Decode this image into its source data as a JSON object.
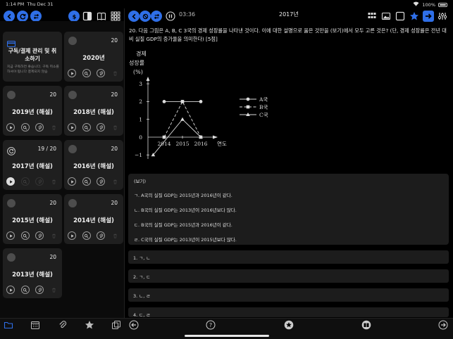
{
  "status": {
    "time": "1:14 PM",
    "date": "Thu Dec 31",
    "battery": "100%"
  },
  "left_panel": {
    "cards": [
      {
        "title": "구독/결제 관리 및 취소하기",
        "subtitle": "지금 구독하면 좋습니다. 구독 취소를 하셔야 됩니다 결제되지 않습",
        "count": ""
      },
      {
        "title": "2020년",
        "count": "20"
      },
      {
        "title": "2019년 (해설)",
        "count": "20"
      },
      {
        "title": "2018년 (해설)",
        "count": "20"
      },
      {
        "title": "2017년 (해설)",
        "count": "19 / 20"
      },
      {
        "title": "2016년 (해설)",
        "count": "20"
      },
      {
        "title": "2015년 (해설)",
        "count": "20"
      },
      {
        "title": "2014년 (해설)",
        "count": "20"
      },
      {
        "title": "2013년 (해설)",
        "count": "20"
      }
    ]
  },
  "header": {
    "title": "2017년",
    "timer": "03:36"
  },
  "question": {
    "text": "20. 다음 그림은 A, B, C 3국의 경제 성장률을 나타낸 것이다. 이에 대한 설명으로 옳은 것만을 (보기)에서 모두 고른 것은? (단, 경제 성장률은 전년 대비 실질 GDP의 증가율을 의미한다) [5점]"
  },
  "chart_data": {
    "type": "line",
    "ylabel_line1": "경제",
    "ylabel_line2": "성장률",
    "ylabel_unit": "(%)",
    "xlabel": "연도",
    "categories": [
      "2014",
      "2015",
      "2016"
    ],
    "y_ticks": [
      "3",
      "2",
      "1",
      "0",
      "−1"
    ],
    "x_origin_label": "0",
    "ylim": [
      -1,
      3
    ],
    "series": [
      {
        "name": "A국",
        "marker": "circle",
        "style": "solid",
        "x": [
          2014,
          2015,
          2016
        ],
        "values": [
          2,
          2,
          2
        ]
      },
      {
        "name": "B국",
        "marker": "square",
        "style": "dashed",
        "x": [
          2014,
          2015,
          2016
        ],
        "values": [
          0,
          2,
          0
        ]
      },
      {
        "name": "C국",
        "marker": "triangle",
        "style": "solid",
        "x": [
          2013.4,
          2015,
          2016
        ],
        "values": [
          -1,
          1,
          0
        ]
      }
    ]
  },
  "bogi": {
    "header": "(보기)",
    "items": [
      "ㄱ. A국의 실질 GDP는 2015년과 2016년이 같다.",
      "ㄴ. B국의 실질 GDP는 2013년이 2016년보다 많다.",
      "ㄷ. B국의 실질 GDP는 2015년과 2016년이 같다.",
      "ㄹ. C국의 실질 GDP는 2013년이 2015년보다 많다."
    ]
  },
  "options": [
    "1. ㄱ, ㄴ",
    "2. ㄱ, ㄷ",
    "3. ㄴ, ㄹ",
    "4. ㄷ, ㄹ"
  ],
  "icons": {
    "top_left": [
      "back-icon",
      "sync-icon",
      "sort-icon",
      "dollar-icon",
      "split-view-icon",
      "book-icon",
      "grid-icon"
    ],
    "top_right": [
      "back-icon",
      "reset-icon",
      "shuffle-icon",
      "pause-icon",
      "grid-icon",
      "image-icon",
      "square-icon",
      "star-icon",
      "next-icon",
      "settings-icon"
    ],
    "bottom": [
      "folder-icon",
      "calendar-icon",
      "paperclip-icon",
      "star-icon",
      "copy-icon",
      "prev-icon",
      "help-icon",
      "star-icon",
      "book-icon",
      "next-icon"
    ]
  },
  "colors": {
    "accent": "#2f6fe8",
    "background": "#000000",
    "card": "#1f1f1f"
  }
}
